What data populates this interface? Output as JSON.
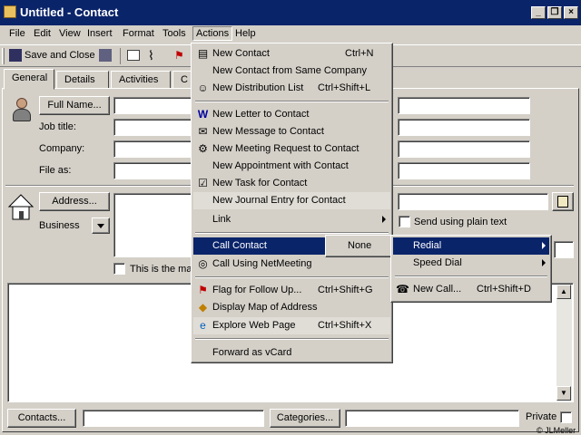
{
  "window": {
    "title": "Untitled - Contact"
  },
  "menubar": [
    "File",
    "Edit",
    "View",
    "Insert",
    "Format",
    "Tools",
    "Actions",
    "Help"
  ],
  "toolbar": {
    "save_close": "Save and Close"
  },
  "tabs": [
    "General",
    "Details",
    "Activities",
    "C"
  ],
  "form": {
    "full_name": "Full Name...",
    "job_title": "Job title:",
    "company": "Company:",
    "file_as": "File as:",
    "address": "Address...",
    "address_type": "Business",
    "plain_text": "Send using plain text",
    "mailing": "This is the mai",
    "contacts": "Contacts...",
    "categories": "Categories...",
    "private": "Private",
    "copyright": "© JLMeller"
  },
  "actions_menu": {
    "new_contact": "New Contact",
    "new_contact_key": "Ctrl+N",
    "new_same_company": "New Contact from Same Company",
    "new_dist_list": "New Distribution List",
    "new_dist_list_key": "Ctrl+Shift+L",
    "new_letter": "New Letter to Contact",
    "new_message": "New Message to Contact",
    "new_meeting": "New Meeting Request to Contact",
    "new_appointment": "New Appointment with Contact",
    "new_task": "New Task for Contact",
    "new_journal": "New Journal Entry for Contact",
    "link": "Link",
    "call_contact": "Call Contact",
    "call_netmeeting": "Call Using NetMeeting",
    "flag": "Flag for Follow Up...",
    "flag_key": "Ctrl+Shift+G",
    "display_map": "Display Map of Address",
    "explore_web": "Explore Web Page",
    "explore_web_key": "Ctrl+Shift+X",
    "forward_vcard": "Forward as vCard"
  },
  "call_submenu": {
    "none": "None"
  },
  "call_submenu2": {
    "redial": "Redial",
    "speed_dial": "Speed Dial",
    "new_call": "New Call...",
    "new_call_key": "Ctrl+Shift+D"
  }
}
